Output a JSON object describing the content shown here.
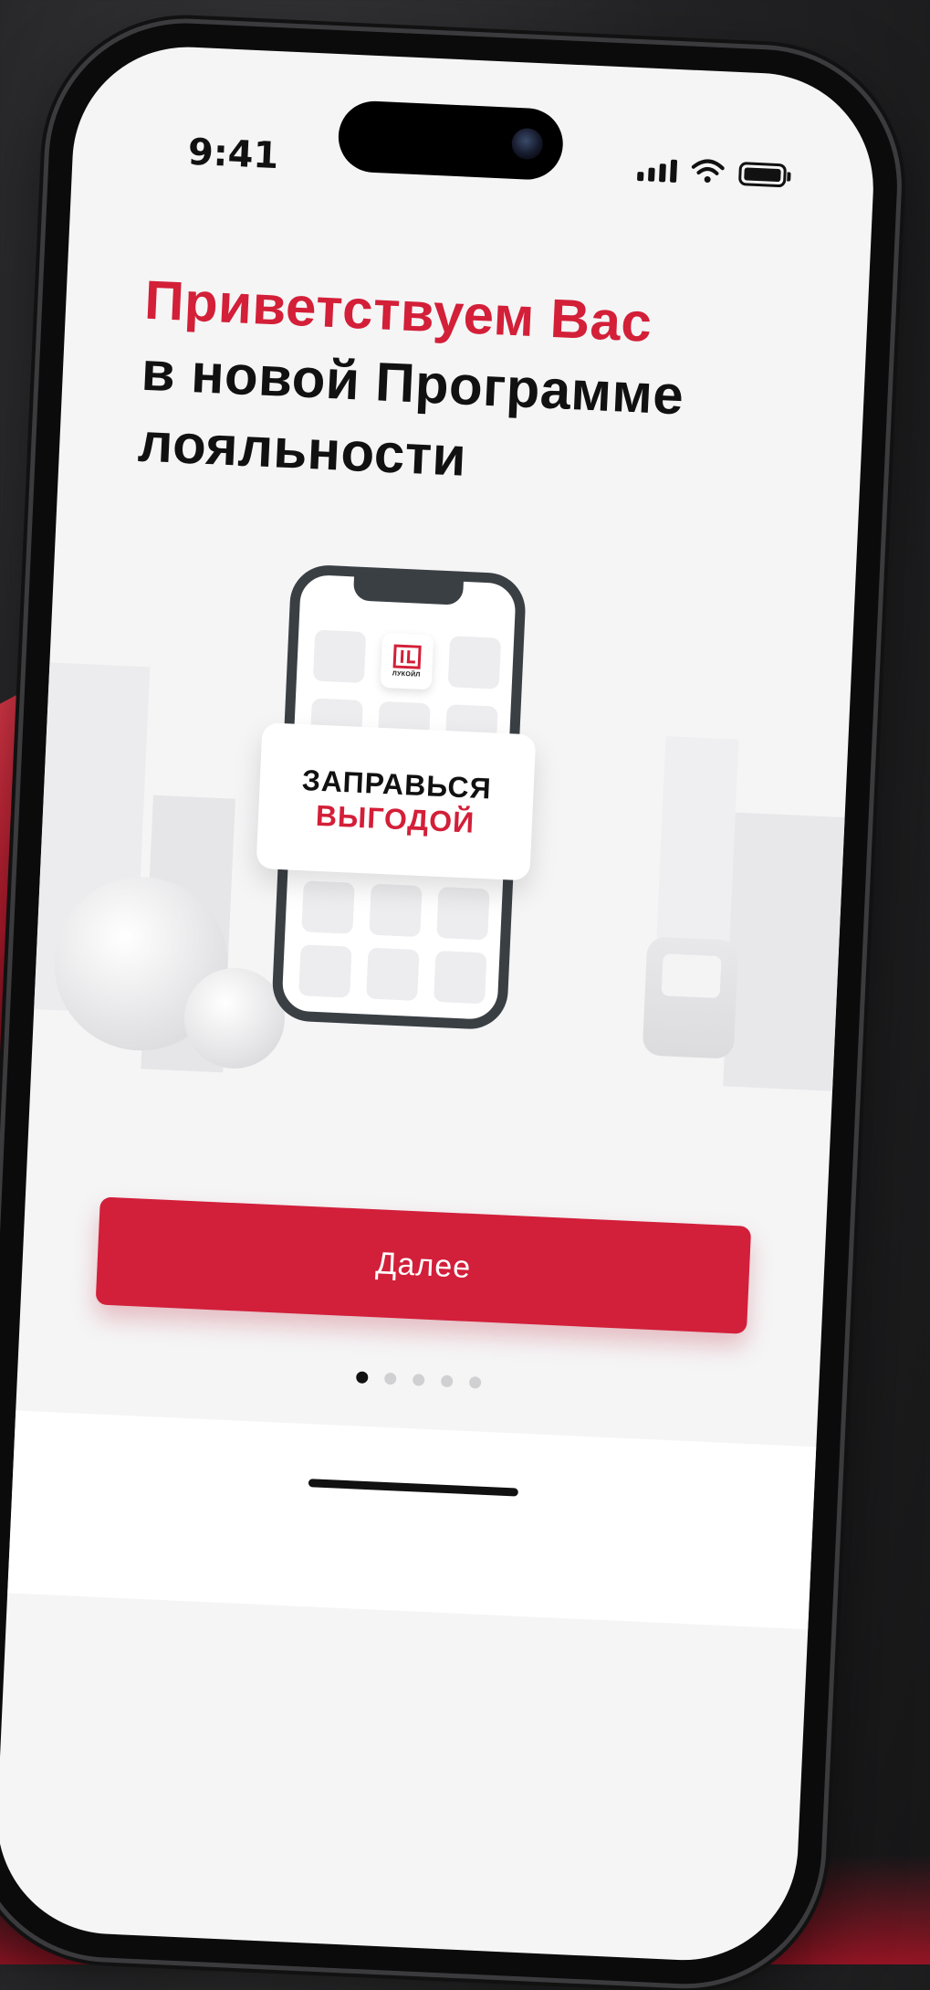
{
  "status_bar": {
    "time": "9:41"
  },
  "headline": {
    "line1": "Приветствуем Вас",
    "line2": "в новой Программе",
    "line3": "лояльности"
  },
  "illustration": {
    "logo_text": "ЛУКОЙЛ",
    "promo_line1": "ЗАПРАВЬСЯ",
    "promo_line2": "ВЫГОДОЙ"
  },
  "cta": {
    "label": "Далее"
  },
  "pagination": {
    "count": 5,
    "active_index": 0
  },
  "colors": {
    "accent": "#d31f38",
    "text": "#111111",
    "background": "#f5f5f6"
  },
  "icons": [
    "signal-icon",
    "wifi-icon",
    "battery-icon",
    "lukoil-logo-icon"
  ]
}
